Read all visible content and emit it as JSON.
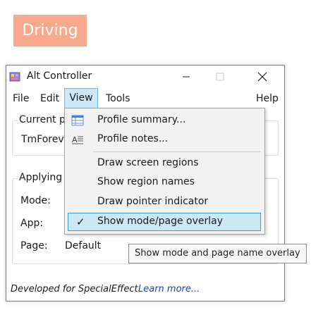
{
  "overlay": {
    "text": "Driving",
    "color": "#f8a98d"
  },
  "window": {
    "title": "Alt Controller",
    "controls": {
      "minimize": "minimize-icon",
      "maximize": "maximize-icon",
      "close": "close-icon"
    }
  },
  "menubar": {
    "file": "File",
    "edit": "Edit",
    "view": "View",
    "tools": "Tools",
    "help": "Help"
  },
  "current_profile": {
    "label": "Current pr",
    "name": "TmForeve"
  },
  "applying": {
    "label": "Applying c",
    "mode_label": "Mode:",
    "app_label": "App:",
    "page_label": "Page:",
    "page_value": "Default"
  },
  "footer": {
    "text": "Developed for SpecialEffect",
    "link": "Learn more..."
  },
  "view_menu": {
    "items": [
      {
        "label": "Profile summary...",
        "icon": "table-icon"
      },
      {
        "label": "Profile notes...",
        "icon": "notes-icon"
      },
      {
        "label": "Draw screen regions"
      },
      {
        "label": "Show region names"
      },
      {
        "label": "Draw pointer indicator"
      },
      {
        "label": "Show mode/page overlay",
        "checked": true
      }
    ]
  },
  "tooltip": {
    "text": "Show mode and page name overlay"
  },
  "colors": {
    "accent": "#cce8f7",
    "accent_border": "#3b9ad8",
    "link": "#1a3fd0"
  }
}
